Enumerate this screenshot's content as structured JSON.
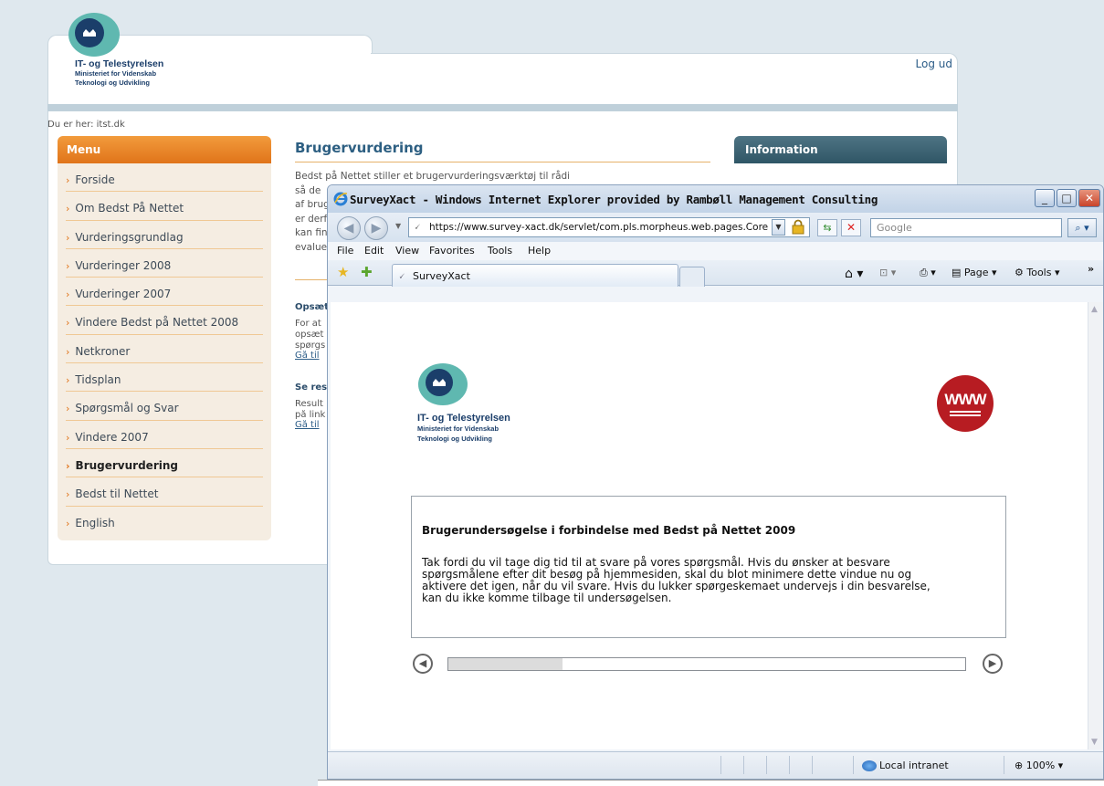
{
  "site": {
    "logout": "Log ud",
    "logo": {
      "title": "IT- og Telestyrelsen",
      "line1": "Ministeriet for Videnskab",
      "line2": "Teknologi og Udvikling"
    },
    "breadcrumb": "Du er her: itst.dk",
    "menu": {
      "heading": "Menu",
      "items": [
        {
          "label": "Forside"
        },
        {
          "label": "Om Bedst På Nettet"
        },
        {
          "label": "Vurderingsgrundlag"
        },
        {
          "label": "Vurderinger 2008"
        },
        {
          "label": "Vurderinger 2007"
        },
        {
          "label": "Vindere Bedst på Nettet 2008"
        },
        {
          "label": "Netkroner"
        },
        {
          "label": "Tidsplan"
        },
        {
          "label": "Spørgsmål og Svar"
        },
        {
          "label": "Vindere 2007"
        },
        {
          "label": "Brugervurdering"
        },
        {
          "label": "Bedst til Nettet"
        },
        {
          "label": "English"
        }
      ]
    },
    "content": {
      "title": "Brugervurdering",
      "intro": [
        "Bedst på Nettet stiller et brugervurderingsværktøj til rådighed for alle deltagere,",
        "så de",
        "af brug",
        "er derf",
        "kan fin",
        "evalue"
      ],
      "section1": {
        "title": "Opsæt",
        "text": [
          "For at",
          "opsæt",
          "spørgs"
        ],
        "link": "Gå til"
      },
      "section2": {
        "title": "Se res",
        "text": [
          "Result",
          "på link"
        ],
        "link": "Gå til"
      }
    },
    "info_heading": "Information"
  },
  "ie": {
    "title": "SurveyXact - Windows Internet Explorer provided by Rambøll Management Consulting",
    "address": "https://www.survey-xact.dk/servlet/com.pls.morpheus.web.pages.Core",
    "search_placeholder": "Google",
    "menu": [
      "File",
      "Edit",
      "View",
      "Favorites",
      "Tools",
      "Help"
    ],
    "tab_title": "SurveyXact",
    "toolbar": {
      "page": "Page",
      "tools": "Tools"
    },
    "status": {
      "zone": "Local intranet",
      "zoom": "100%"
    }
  },
  "survey": {
    "logo": {
      "title": "IT- og Telestyrelsen",
      "line1": "Ministeriet for Videnskab",
      "line2": "Teknologi og Udvikling"
    },
    "badge": "WWW",
    "heading": "Brugerundersøgelse i forbindelse med Bedst på Nettet 2009",
    "body": [
      "Tak fordi du vil tage dig tid til at svare på vores spørgsmål. Hvis du ønsker at besvare",
      "spørgsmålene efter dit besøg på hjemmesiden, skal du blot minimere dette vindue nu og",
      "aktivere det igen, når du vil svare. Hvis du lukker spørgeskemaet undervejs i din besvarelse,",
      "kan du ikke komme tilbage til undersøgelsen."
    ],
    "progress_fraction": 0.22
  },
  "colors": {
    "menu_header": "#e0741a",
    "info_header": "#2f5666",
    "content_title": "#2d5f82",
    "www_badge": "#b71c22"
  }
}
